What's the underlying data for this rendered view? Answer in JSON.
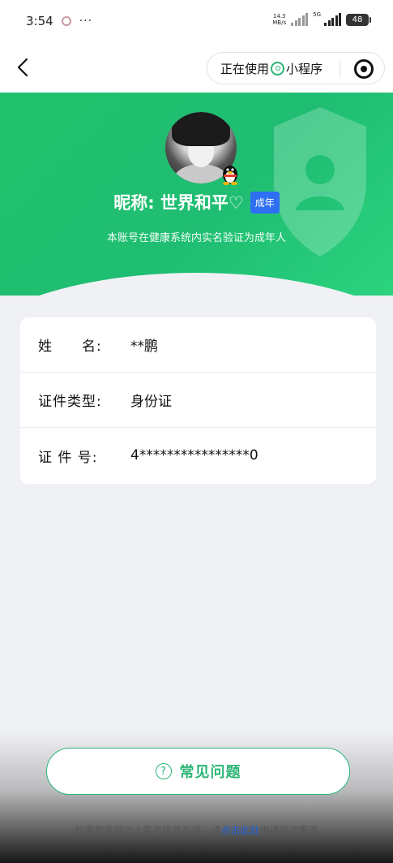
{
  "status_bar": {
    "time": "3:54",
    "dots": "···",
    "net_speed_top": "14.3",
    "net_speed_bottom": "MB/s",
    "sim2_label": "5G",
    "battery": "48"
  },
  "nav": {
    "back_icon": "chevron-left-icon",
    "capsule_text_before": "正在使用",
    "capsule_text_after": "小程序",
    "capsule_icon": "miniprogram-icon",
    "close_icon": "target-icon"
  },
  "profile": {
    "nickname": "昵称: 世界和平♡",
    "age_badge": "成年",
    "note": "本账号在健康系统内实名验证为成年人",
    "accent_color": "#21c16b",
    "badge_color": "#2f6ff3"
  },
  "info": {
    "rows": [
      {
        "label": "姓　　名:",
        "value": "**鹏"
      },
      {
        "label": "证件类型:",
        "value": "身份证"
      },
      {
        "label": "证 件 号:",
        "value": "4****************0"
      }
    ]
  },
  "faq": {
    "icon": "?",
    "label": "常见问题"
  },
  "footer": {
    "before": "如果您发现以上实名信息有误，请",
    "link": "点击此处",
    "after": "申请再次更改"
  }
}
